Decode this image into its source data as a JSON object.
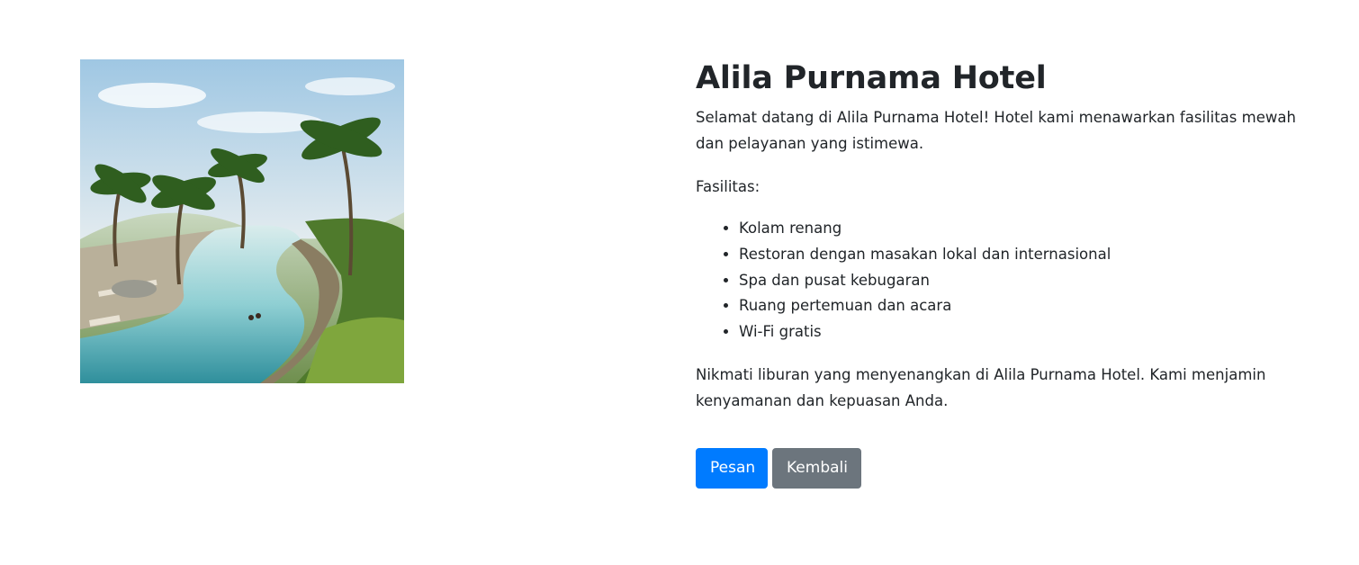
{
  "hotel": {
    "name": "Alila Purnama Hotel",
    "intro": "Selamat datang di Alila Purnama Hotel! Hotel kami menawarkan fasilitas mewah dan pelayanan yang istimewa.",
    "facilities_label": "Fasilitas:",
    "facilities": [
      "Kolam renang",
      "Restoran dengan masakan lokal dan internasional",
      "Spa dan pusat kebugaran",
      "Ruang pertemuan dan acara",
      "Wi-Fi gratis"
    ],
    "closing": "Nikmati liburan yang menyenangkan di Alila Purnama Hotel. Kami menjamin kenyamanan dan kepuasan Anda."
  },
  "actions": {
    "book_label": "Pesan",
    "back_label": "Kembali",
    "book_color": "#007bff",
    "back_color": "#6c757d"
  }
}
